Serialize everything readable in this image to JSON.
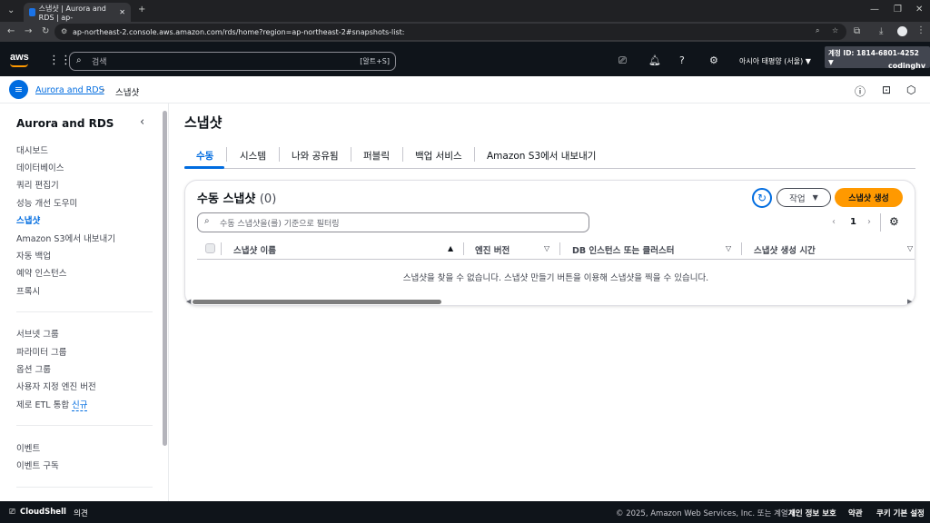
{
  "browser": {
    "tab_title": "스냅샷 | Aurora and RDS | ap-",
    "url": "ap-northeast-2.console.aws.amazon.com/rds/home?region=ap-northeast-2#snapshots-list:"
  },
  "aws_nav": {
    "logo": "aws",
    "search_placeholder": "검색",
    "search_shortcut": "[알트+S]",
    "region": "아시아 태평양 (서울) ▼",
    "account": "계정 ID: 1814-6801-4252 ▼",
    "user": "codinghv"
  },
  "breadcrumb": {
    "root": "Aurora and RDS",
    "current": "스냅샷"
  },
  "sidebar": {
    "title": "Aurora and RDS",
    "group1": [
      "대시보드",
      "데이터베이스",
      "쿼리 편집기",
      "성능 개선 도우미",
      "스냅샷",
      "Amazon S3에서 내보내기",
      "자동 백업",
      "예약 인스턴스",
      "프록시"
    ],
    "group2": [
      "서브넷 그룹",
      "파라미터 그룹",
      "옵션 그룹",
      "사용자 지정 엔진 버전",
      "제로 ETL 통합"
    ],
    "new_badge": "신규",
    "group3": [
      "이벤트",
      "이벤트 구독"
    ]
  },
  "main": {
    "page_title": "스냅샷",
    "tabs": [
      "수동",
      "시스템",
      "나와 공유됨",
      "퍼블릭",
      "백업 서비스",
      "Amazon S3에서 내보내기"
    ],
    "card_title": "수동 스냅샷",
    "card_count": "(0)",
    "action_button": "작업",
    "create_button": "스냅샷 생성",
    "filter_placeholder": "수동 스냅샷을(를) 기준으로 필터링",
    "page_number": "1",
    "columns": [
      "스냅샷 이름",
      "엔진 버전",
      "DB 인스턴스 또는 클러스터",
      "스냅샷 생성 시간"
    ],
    "empty_message": "스냅샷을 찾을 수 없습니다. 스냅샷 만들기 버튼을 이용해 스냅샷을 찍을 수 있습니다."
  },
  "footer": {
    "cloudshell": "CloudShell",
    "feedback": "의견",
    "copyright": "© 2025, Amazon Web Services, Inc. 또는 계열사.",
    "privacy": "개인 정보 보호",
    "terms": "약관",
    "cookies": "쿠키 기본 설정"
  }
}
